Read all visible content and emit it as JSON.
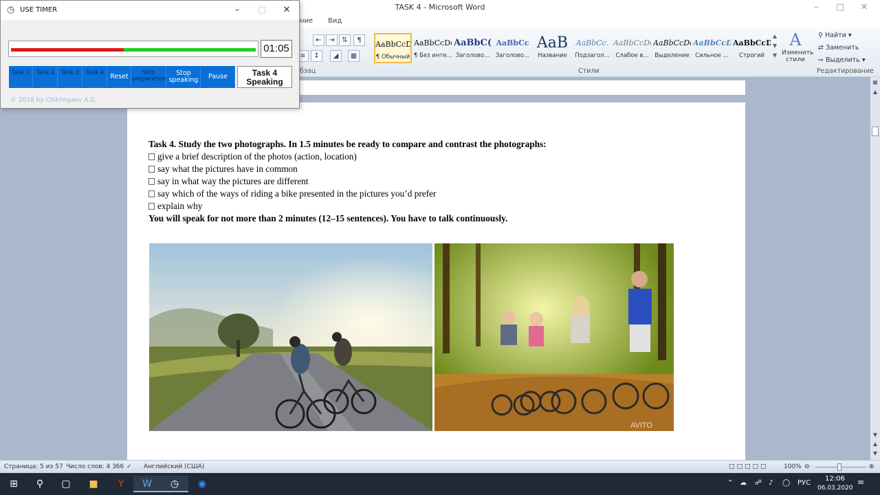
{
  "word": {
    "title": "TASK 4 - Microsoft Word",
    "tabs": [
      "ние",
      "Вид"
    ],
    "groups": {
      "paragraph": "бзац",
      "styles": "Стили",
      "editing": "Редактирование"
    },
    "styles": [
      {
        "sample": "AaBbCcDc",
        "name": "¶ Обычный"
      },
      {
        "sample": "AaBbCcDc",
        "name": "¶ Без инте..."
      },
      {
        "sample": "AaBbC(",
        "name": "Заголово..."
      },
      {
        "sample": "AaBbCc",
        "name": "Заголово..."
      },
      {
        "sample": "AaB",
        "name": "Название"
      },
      {
        "sample": "AaBbCc.",
        "name": "Подзагол..."
      },
      {
        "sample": "AaBbCcDc",
        "name": "Слабое в..."
      },
      {
        "sample": "AaBbCcDc",
        "name": "Выделение"
      },
      {
        "sample": "AaBbCcDc",
        "name": "Сильное ..."
      },
      {
        "sample": "AaBbCcDc",
        "name": "Строгий"
      }
    ],
    "change_styles": "Изменить стили",
    "editing": {
      "find": "Найти",
      "replace": "Заменить",
      "select": "Выделить"
    }
  },
  "document": {
    "task_heading": "Task 4. Study the two photographs. In 1.5 minutes be ready to compare and contrast the photographs:",
    "bullets": [
      "give a brief description of the photos (action, location)",
      "say what the pictures have in common",
      "say in what way the pictures are different",
      "say which of the ways of riding a bike presented in the pictures you’d prefer",
      "explain why"
    ],
    "closing": "You will speak for not more than 2 minutes (12–15 sentences). You have to talk continuously.",
    "photo_watermark": "AVITO"
  },
  "status": {
    "page": "Страница: 5 из 57",
    "words": "Число слов: 4 366",
    "language": "Английский (США)",
    "zoom": "100%"
  },
  "taskbar": {
    "lang": "РУС",
    "time": "12:06",
    "date": "06.03.2020"
  },
  "timer": {
    "title": "USE TIMER",
    "time": "01:05",
    "progress": 0.46,
    "buttons": [
      "Task 1",
      "Task 2",
      "Task 3",
      "Task 4",
      "Reset",
      "Skip preparation",
      "Stop speaking",
      "Pause"
    ],
    "current_task": "Task 4 Speaking",
    "copyright": "© 2018 by Chikhnyaev A.G.",
    "colors": {
      "elapsed": "#e01818",
      "remaining": "#1fd01f",
      "buttons": "#0078d7"
    }
  }
}
